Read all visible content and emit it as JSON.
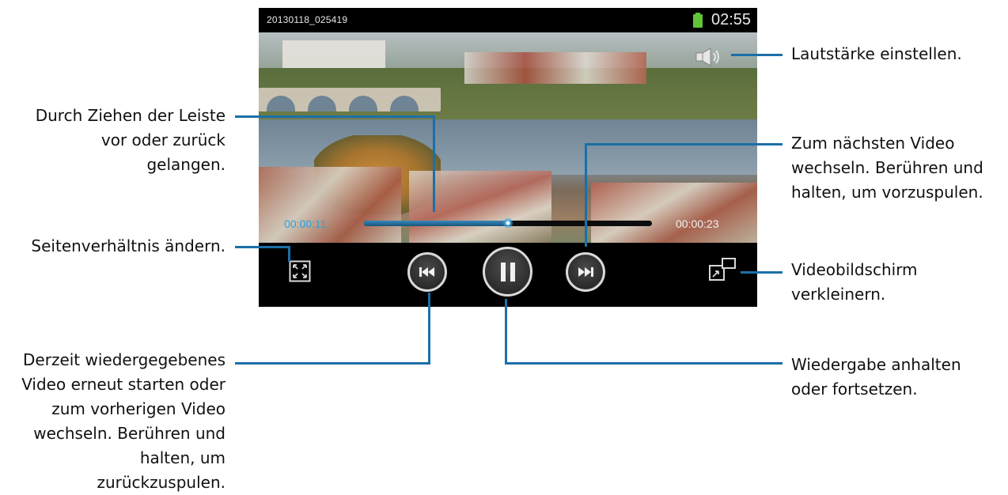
{
  "status_bar": {
    "file_name": "20130118_025419",
    "clock": "02:55",
    "battery_color": "#5fc43a"
  },
  "player": {
    "elapsed_time": "00:00:11",
    "total_time": "00:00:23",
    "progress_fraction": 0.5,
    "accent_color": "#29a3d9",
    "icons": {
      "volume": "speaker-icon",
      "aspect_ratio": "aspect-ratio-icon",
      "previous": "skip-previous-icon",
      "pause": "pause-icon",
      "next": "skip-next-icon",
      "minimize": "pop-up-play-icon"
    }
  },
  "callouts": {
    "volume": "Lautstärke einstellen.",
    "seek": [
      "Durch Ziehen der Leiste",
      "vor oder zurück",
      "gelangen."
    ],
    "next": [
      "Zum nächsten Video",
      "wechseln. Berühren und",
      "halten, um vorzuspulen."
    ],
    "aspect": "Seitenverhältnis ändern.",
    "minimize": [
      "Videobildschirm",
      "verkleinern."
    ],
    "previous": [
      "Derzeit wiedergegebenes",
      "Video erneut starten oder",
      "zum vorherigen Video",
      "wechseln. Berühren und",
      "halten, um",
      "zurückzuspulen."
    ],
    "pause": [
      "Wiedergabe anhalten",
      "oder fortsetzen."
    ]
  },
  "callout_line_color": "#1b6fa8"
}
